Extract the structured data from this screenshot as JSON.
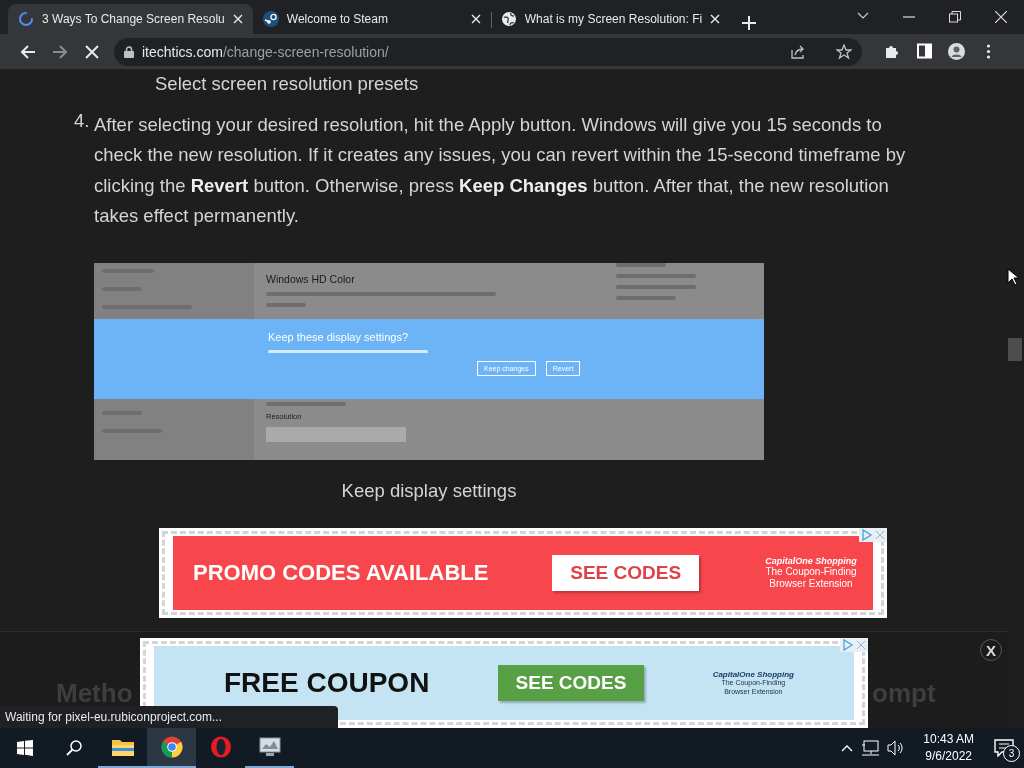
{
  "tabs": [
    {
      "title": "3 Ways To Change Screen Resolu",
      "kind": "loading",
      "selected": true
    },
    {
      "title": "Welcome to Steam",
      "kind": "steam",
      "selected": false
    },
    {
      "title": "What is my Screen Resolution: Fi",
      "kind": "globe",
      "selected": false
    }
  ],
  "address_bar": {
    "host": "itechtics.com",
    "path": "/change-screen-resolution/"
  },
  "article": {
    "caption_top": "Select screen resolution presets",
    "steps": [
      {
        "number": "4.",
        "text": "After selecting your desired resolution, hit the Apply button. Windows will give you 15 seconds to check the new resolution. If it creates any issues, you can revert within the 15-second timeframe by clicking the **Revert** button. Otherwise, press **Keep Changes** button. After that, the new resolution takes effect permanently."
      }
    ],
    "figure": {
      "window_heading": "Windows HD Color",
      "dialog_title": "Keep these display settings?",
      "buttons": [
        "Keep changes",
        "Revert"
      ],
      "field_label": "Resolution"
    },
    "figure_caption": "Keep display settings",
    "ad": {
      "kind": "promo",
      "headline": "PROMO CODES AVAILABLE",
      "button": "SEE CODES",
      "brand": "CapitalOne Shopping",
      "tagline": "The Coupon-Finding Browser Extension"
    }
  },
  "sticky_ad": {
    "kind": "coupon",
    "headline": "FREE COUPON",
    "button": "SEE CODES",
    "brand": "CapitalOne Shopping",
    "tagline": "The Coupon-Finding Browser Extension",
    "close": "X"
  },
  "hidden_heading": [
    "Metho",
    "ompt"
  ],
  "status_bubble": "Waiting for pixel-eu.rubiconproject.com...",
  "taskbar": {
    "apps": [
      {
        "kind": "folder",
        "running": true,
        "selected": false
      },
      {
        "kind": "chrome",
        "running": true,
        "selected": true
      },
      {
        "kind": "opera",
        "running": false,
        "selected": false
      },
      {
        "kind": "monitor",
        "running": true,
        "selected": false
      }
    ],
    "time": "10:43 AM",
    "date": "9/6/2022",
    "notifications": "3"
  }
}
